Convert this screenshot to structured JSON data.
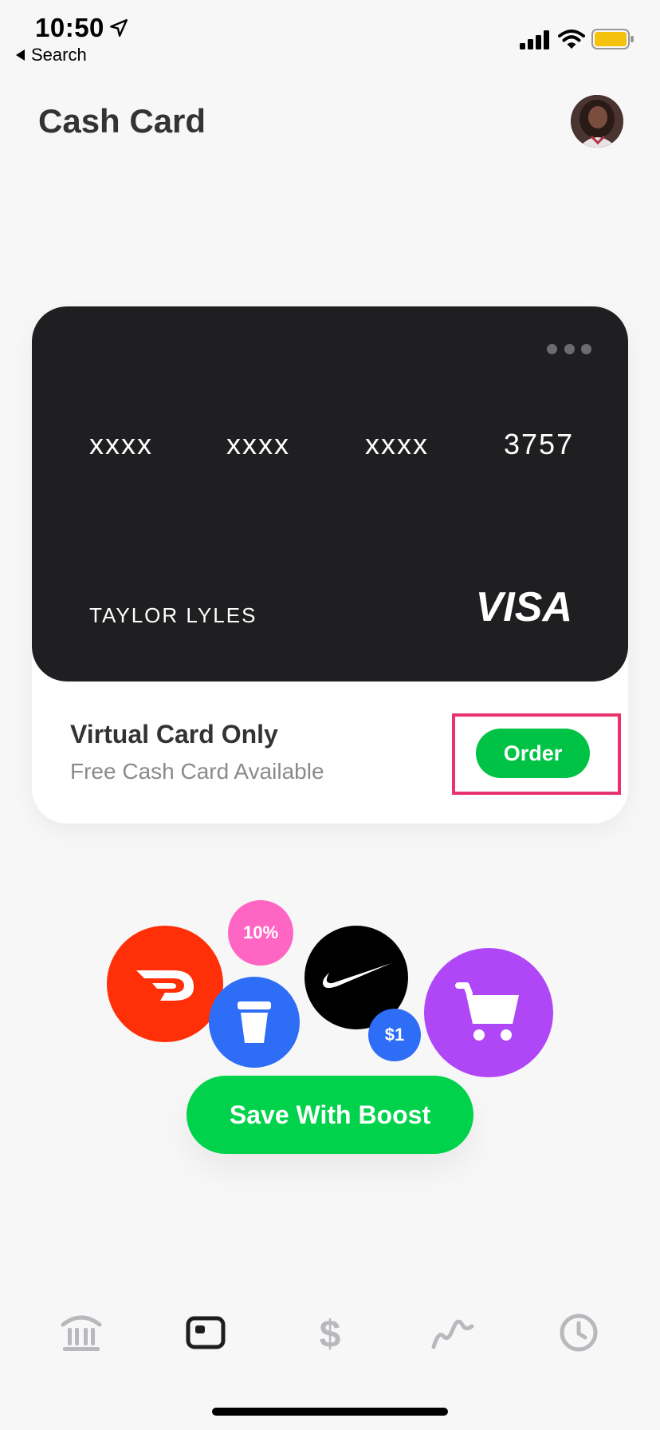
{
  "status_bar": {
    "time": "10:50",
    "back_label": "Search"
  },
  "header": {
    "title": "Cash Card"
  },
  "card": {
    "number_groups": [
      "xxxx",
      "xxxx",
      "xxxx",
      "3757"
    ],
    "holder_name": "TAYLOR LYLES",
    "network": "VISA",
    "color": "#1f1f21"
  },
  "card_status": {
    "title": "Virtual Card Only",
    "subtitle": "Free Cash Card Available",
    "order_label": "Order"
  },
  "boost": {
    "percent_badge": "10%",
    "dollar_badge": "$1",
    "button_label": "Save With Boost",
    "merchant_icons": [
      "doordash-icon",
      "coffee-cup-icon",
      "nike-swoosh-icon",
      "shopping-cart-icon"
    ]
  },
  "tab_bar": {
    "tabs": [
      {
        "icon": "bank-icon",
        "active": false
      },
      {
        "icon": "card-icon",
        "active": true
      },
      {
        "icon": "dollar-icon",
        "active": false
      },
      {
        "icon": "investing-icon",
        "active": false
      },
      {
        "icon": "activity-clock-icon",
        "active": false
      }
    ]
  },
  "colors": {
    "accent_green": "#00d24b",
    "highlight_pink": "#e8336d",
    "tab_inactive": "#b9b9bd"
  }
}
